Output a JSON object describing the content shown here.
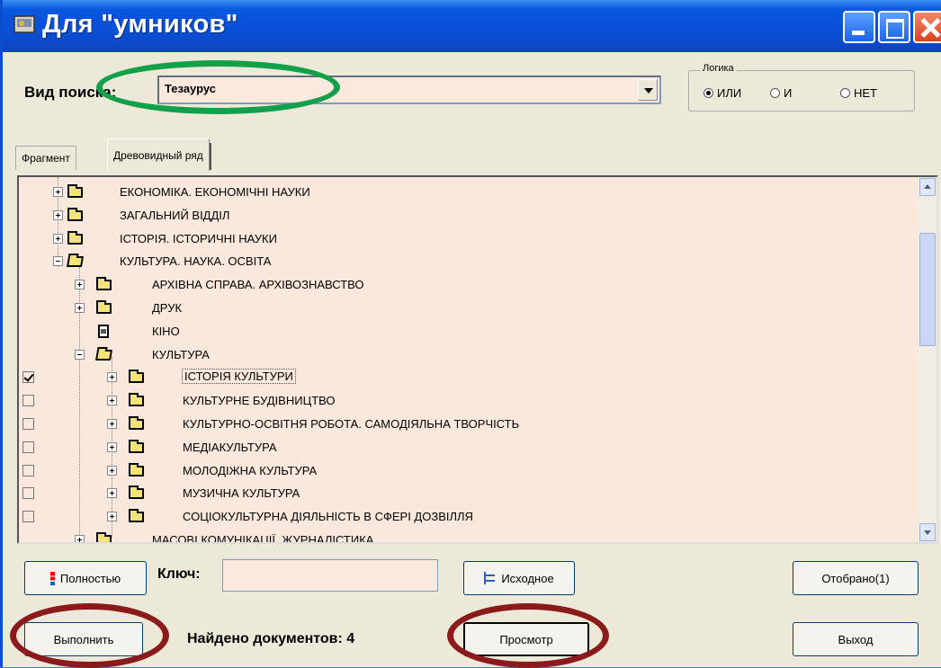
{
  "window": {
    "title": "Для \"умников\"",
    "icon": "app-icon"
  },
  "search": {
    "label": "Вид поиска:",
    "value": "Тезаурус"
  },
  "logic": {
    "legend": "Логика",
    "options": [
      "ИЛИ",
      "И",
      "НЕТ"
    ],
    "selected": "ИЛИ"
  },
  "tabs": [
    "Фрагмент",
    "Древовидный ряд"
  ],
  "active_tab": "Древовидный ряд",
  "tree": {
    "items": [
      {
        "label": "ЕКОНОМІКА. ЕКОНОМІЧНІ НАУКИ",
        "level": 0,
        "type": "folder",
        "expanded": false
      },
      {
        "label": "ЗАГАЛЬНИЙ ВІДДІЛ",
        "level": 0,
        "type": "folder",
        "expanded": false
      },
      {
        "label": "ІСТОРІЯ. ІСТОРИЧНІ НАУКИ",
        "level": 0,
        "type": "folder",
        "expanded": false
      },
      {
        "label": "КУЛЬТУРА. НАУКА. ОСВІТА",
        "level": 0,
        "type": "folder",
        "expanded": true
      },
      {
        "label": "АРХІВНА СПРАВА. АРХІВОЗНАВСТВО",
        "level": 1,
        "type": "folder",
        "expanded": false
      },
      {
        "label": "ДРУК",
        "level": 1,
        "type": "folder",
        "expanded": false
      },
      {
        "label": "КІНО",
        "level": 1,
        "type": "document"
      },
      {
        "label": "КУЛЬТУРА",
        "level": 1,
        "type": "folder",
        "expanded": true
      },
      {
        "label": "ІСТОРІЯ КУЛЬТУРИ",
        "level": 2,
        "type": "folder",
        "expanded": false,
        "checked": true,
        "selected": true
      },
      {
        "label": "КУЛЬТУРНЕ БУДІВНИЦТВО",
        "level": 2,
        "type": "folder",
        "expanded": false,
        "checked": false
      },
      {
        "label": "КУЛЬТУРНО-ОСВІТНЯ РОБОТА. САМОДІЯЛЬНА ТВОРЧІСТЬ",
        "level": 2,
        "type": "folder",
        "expanded": false,
        "checked": false
      },
      {
        "label": "МЕДІАКУЛЬТУРА",
        "level": 2,
        "type": "folder",
        "expanded": false,
        "checked": false
      },
      {
        "label": "МОЛОДІЖНА КУЛЬТУРА",
        "level": 2,
        "type": "folder",
        "expanded": false,
        "checked": false
      },
      {
        "label": "МУЗИЧНА КУЛЬТУРА",
        "level": 2,
        "type": "folder",
        "expanded": false,
        "checked": false
      },
      {
        "label": "СОЦІОКУЛЬТУРНА ДІЯЛЬНІСТЬ В СФЕРІ ДОЗВІЛЛЯ",
        "level": 2,
        "type": "folder",
        "expanded": false,
        "checked": false
      },
      {
        "label": "МАСОВІ КОМУНІКАЦІЇ. ЖУРНАЛІСТИКА",
        "level": 1,
        "type": "folder",
        "expanded": false
      }
    ]
  },
  "toolbar": {
    "full_label": "Полностью",
    "key_label": "Ключ:",
    "key_value": "",
    "source_label": "Исходное",
    "selected_label": "Отобрано(1)"
  },
  "bottom": {
    "execute_label": "Выполнить",
    "found_label": "Найдено документов: 4",
    "view_label": "Просмотр",
    "exit_label": "Выход"
  },
  "colors": {
    "highlight_green": "#13a04a",
    "highlight_red": "#8b1a1a",
    "field_background": "#fbe9dd"
  }
}
